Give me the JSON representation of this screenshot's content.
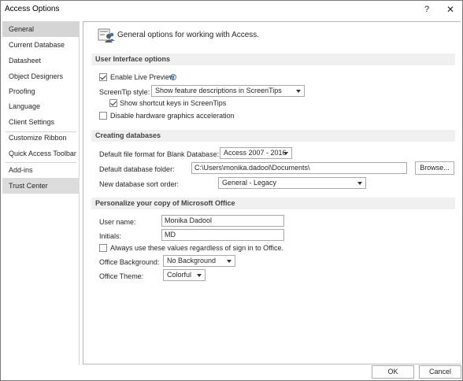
{
  "window": {
    "title": "Access Options",
    "help": "?",
    "close": "✕"
  },
  "sidebar": {
    "items": [
      {
        "label": "General"
      },
      {
        "label": "Current Database"
      },
      {
        "label": "Datasheet"
      },
      {
        "label": "Object Designers"
      },
      {
        "label": "Proofing"
      },
      {
        "label": "Language"
      },
      {
        "label": "Client Settings"
      },
      {
        "label": "Customize Ribbon"
      },
      {
        "label": "Quick Access Toolbar"
      },
      {
        "label": "Add-ins"
      },
      {
        "label": "Trust Center"
      }
    ]
  },
  "header": {
    "text": "General options for working with Access."
  },
  "ui_options": {
    "title": "User Interface options",
    "live_preview": "Enable Live Preview",
    "screentip_label": "ScreenTip style:",
    "screentip_value": "Show feature descriptions in ScreenTips",
    "shortcut_keys": "Show shortcut keys in ScreenTips",
    "disable_hw": "Disable hardware graphics acceleration"
  },
  "creating": {
    "title": "Creating databases",
    "format_label": "Default file format for Blank Database:",
    "format_value": "Access 2007 - 2016",
    "folder_label": "Default database folder:",
    "folder_value": "C:\\Users\\monika.dadool\\Documents\\",
    "browse": "Browse...",
    "sort_label": "New database sort order:",
    "sort_value": "General - Legacy"
  },
  "personalize": {
    "title": "Personalize your copy of Microsoft Office",
    "username_label": "User name:",
    "username_value": "Monika Dadool",
    "initials_label": "Initials:",
    "initials_value": "MD",
    "always_use": "Always use these values regardless of sign in to Office.",
    "background_label": "Office Background:",
    "background_value": "No Background",
    "theme_label": "Office Theme:",
    "theme_value": "Colorful"
  },
  "footer": {
    "ok": "OK",
    "cancel": "Cancel"
  },
  "icons": {
    "info": "info-icon",
    "header": "general-options-icon"
  }
}
